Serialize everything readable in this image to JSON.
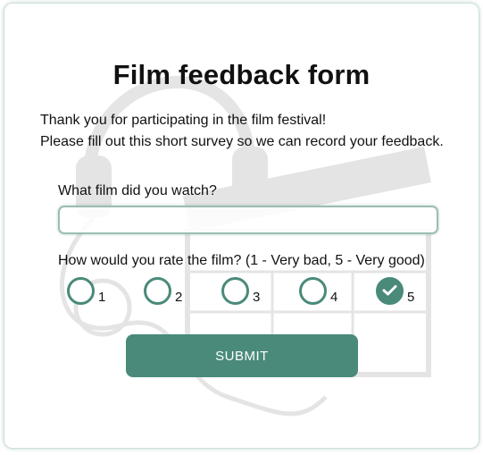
{
  "form": {
    "title": "Film feedback form",
    "intro_line1": "Thank you for participating in the film festival!",
    "intro_line2": "Please fill out this short survey so we can record your feedback.",
    "film_question": "What film did you watch?",
    "film_value": "",
    "film_placeholder": "",
    "rating_question": "How would you rate the film? (1 - Very bad, 5 - Very good)",
    "rating_options": [
      "1",
      "2",
      "3",
      "4",
      "5"
    ],
    "selected_rating": "5",
    "submit_label": "SUBMIT"
  },
  "colors": {
    "accent": "#4a8a7a",
    "text": "#111111",
    "border": "#9bbdb3"
  },
  "icons": {
    "selected_mark": "checkmark-icon",
    "background": "headphones-and-clapperboard-illustration"
  }
}
